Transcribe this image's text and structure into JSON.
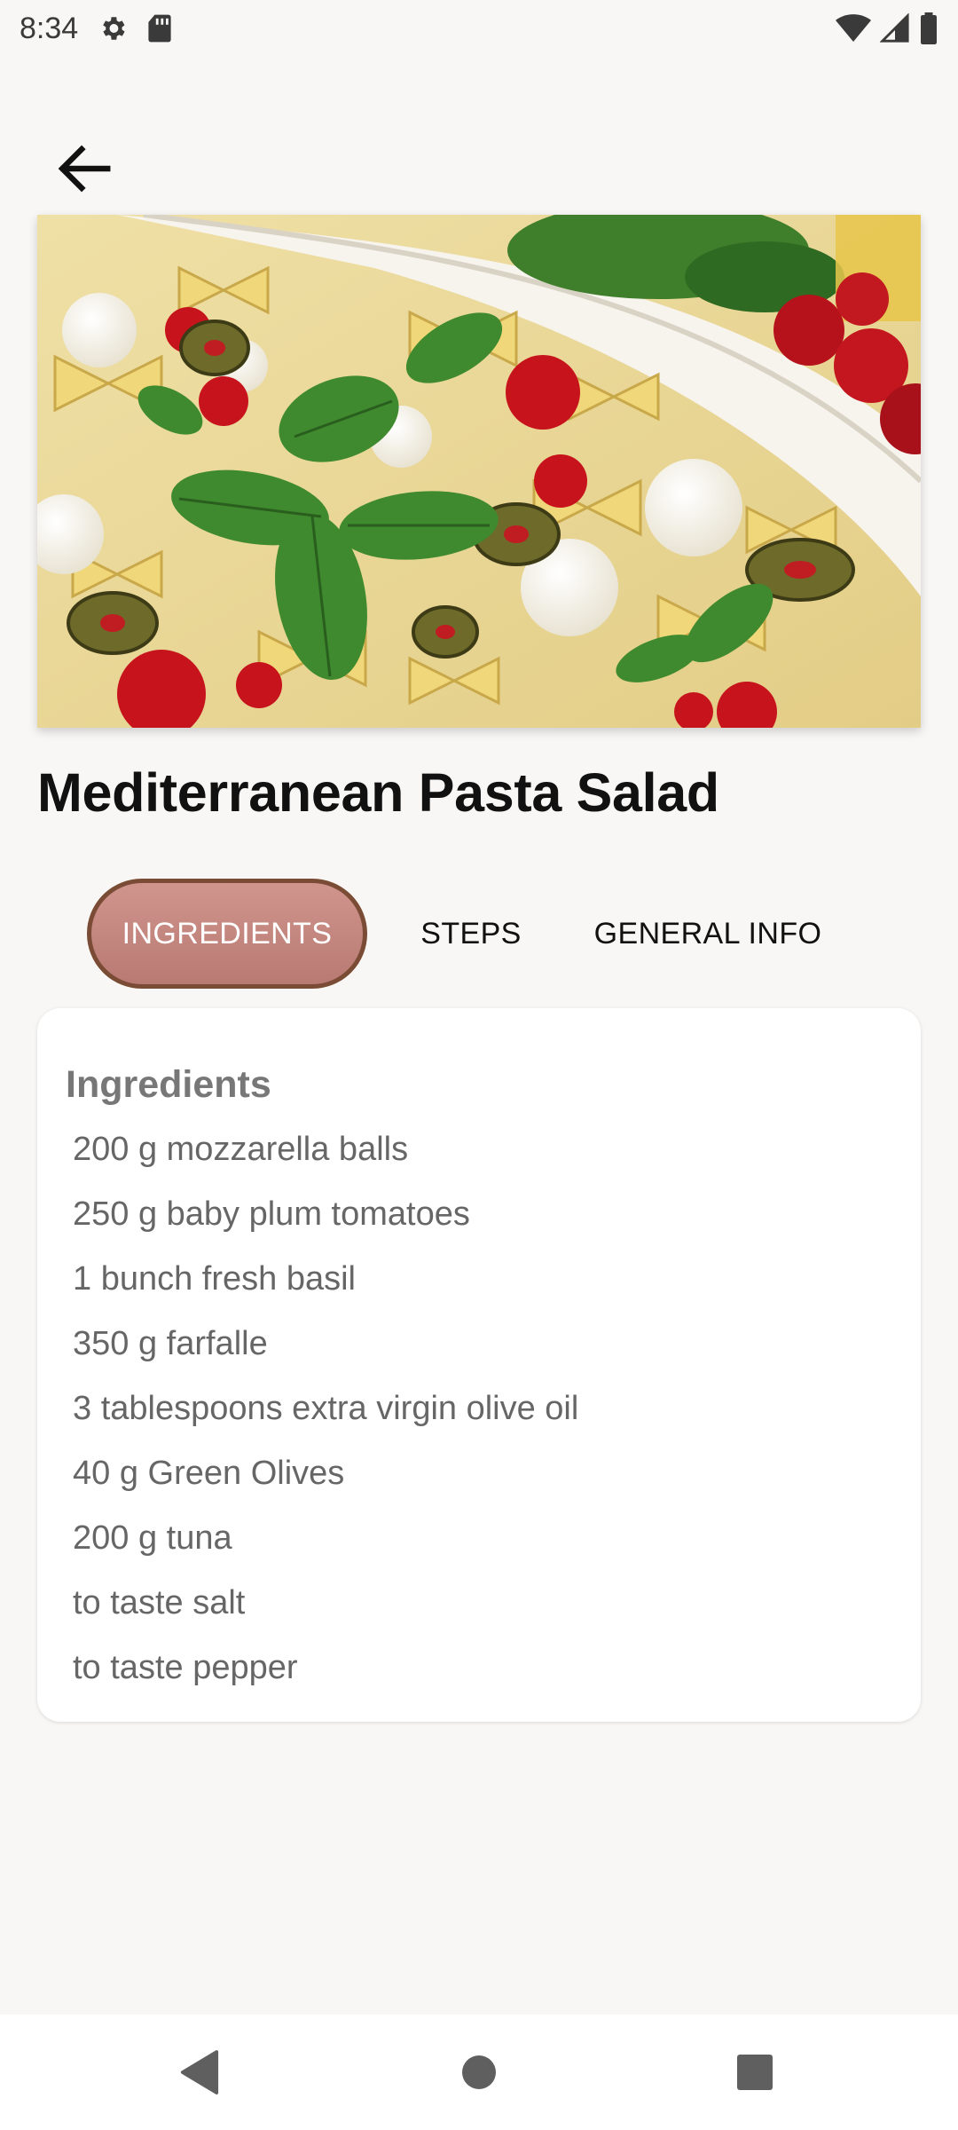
{
  "status_bar": {
    "time": "8:34",
    "left_icons": [
      "gear-icon",
      "sd-card-icon"
    ],
    "right_icons": [
      "wifi-icon",
      "signal-icon",
      "battery-icon"
    ]
  },
  "header": {
    "back_icon": "arrow-back-icon"
  },
  "recipe": {
    "title": "Mediterranean Pasta Salad",
    "image_alt": "Mediterranean pasta salad photo"
  },
  "tabs": [
    {
      "label": "INGREDIENTS",
      "active": true
    },
    {
      "label": "STEPS",
      "active": false
    },
    {
      "label": "GENERAL INFO",
      "active": false
    }
  ],
  "ingredients": {
    "heading": "Ingredients",
    "items": [
      "200 g mozzarella balls",
      "250 g baby plum tomatoes",
      "1  bunch fresh basil",
      "350 g farfalle",
      "3  tablespoons extra virgin olive oil",
      "40 g Green Olives",
      "200 g tuna",
      "to taste salt",
      "to taste pepper"
    ]
  },
  "nav_bar": {
    "buttons": [
      "back-triangle-icon",
      "home-circle-icon",
      "recents-square-icon"
    ]
  },
  "colors": {
    "background": "#f9f7f5",
    "active_tab_fill": "#c68a82",
    "active_tab_border": "#7a4b35",
    "ingredient_text": "#666666"
  }
}
